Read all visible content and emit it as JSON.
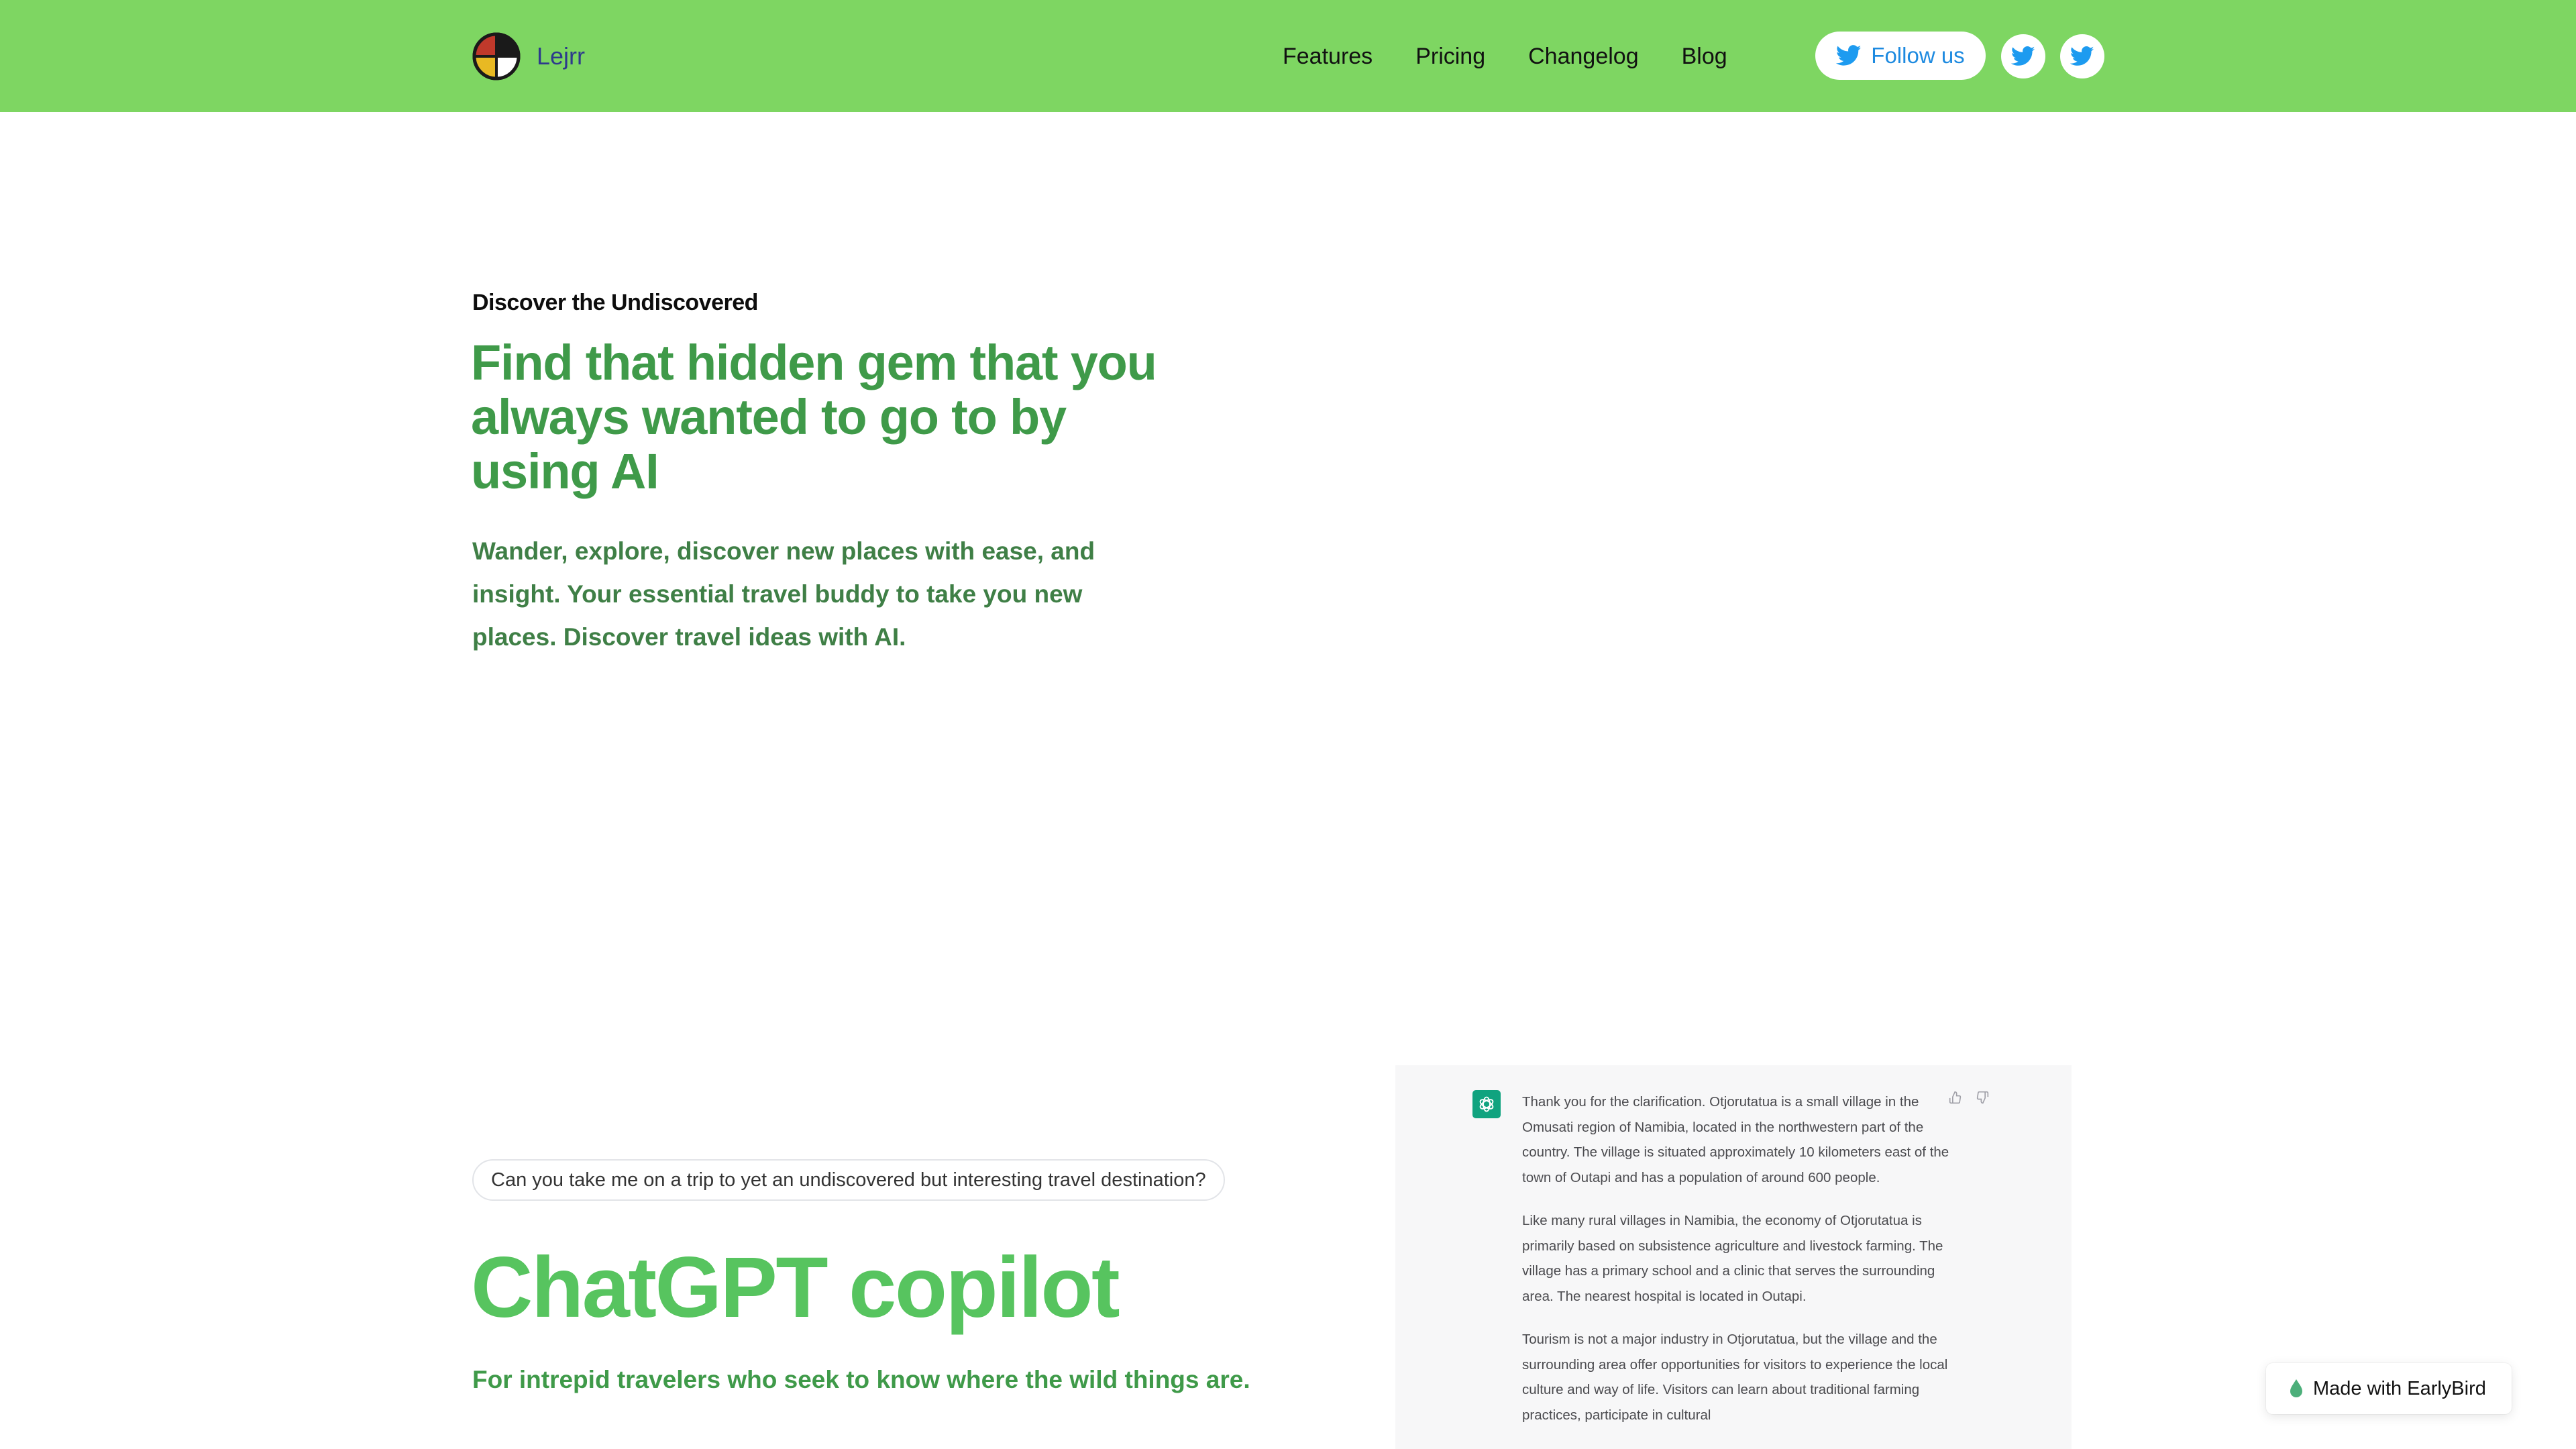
{
  "header": {
    "brand": "Lejrr",
    "nav": [
      "Features",
      "Pricing",
      "Changelog",
      "Blog"
    ],
    "follow_label": "Follow us",
    "bg_color": "#7ed662"
  },
  "hero": {
    "eyebrow": "Discover the Undiscovered",
    "title": "Find that hidden gem that you always wanted to go to by using AI",
    "subtitle": "Wander, explore, discover new places with ease, and insight. Your essential travel buddy to take you new places. Discover travel ideas with AI."
  },
  "copilot": {
    "prompt": "Can you take me on a trip to yet an undiscovered but interesting travel destination?",
    "title": "ChatGPT copilot",
    "subtitle": "For intrepid travelers who seek to know where the wild things are."
  },
  "chat": {
    "paragraphs": [
      "Thank you for the clarification. Otjorutatua is a small village in the Omusati region of Namibia, located in the northwestern part of the country. The village is situated approximately 10 kilometers east of the town of Outapi and has a population of around 600 people.",
      "Like many rural villages in Namibia, the economy of Otjorutatua is primarily based on subsistence agriculture and livestock farming. The village has a primary school and a clinic that serves the surrounding area. The nearest hospital is located in Outapi.",
      "Tourism is not a major industry in Otjorutatua, but the village and the surrounding area offer opportunities for visitors to experience the local culture and way of life. Visitors can learn about traditional farming practices, participate in cultural"
    ],
    "icons": [
      "openai-logo",
      "thumbs-up",
      "thumbs-down"
    ]
  },
  "badge": {
    "label": "Made with EarlyBird"
  },
  "colors": {
    "accent_green": "#3f9a49",
    "bright_green": "#57c45f",
    "twitter_blue": "#1d9bf0"
  }
}
